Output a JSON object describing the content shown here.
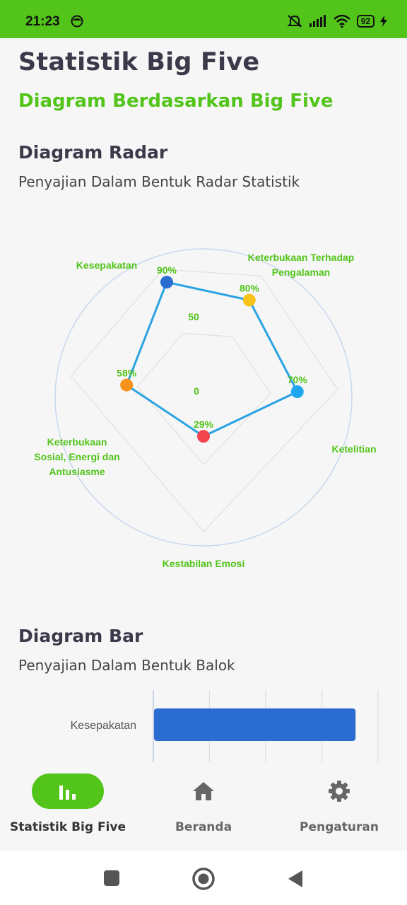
{
  "status_bar": {
    "time": "21:23",
    "battery": "92"
  },
  "page": {
    "title": "Statistik Big Five",
    "subtitle": "Diagram Berdasarkan Big Five"
  },
  "radar_section": {
    "title": "Diagram Radar",
    "description": "Penyajian Dalam Bentuk Radar Statistik"
  },
  "bar_section": {
    "title": "Diagram Bar",
    "description": "Penyajian Dalam Bentuk Balok"
  },
  "chart_data": [
    {
      "type": "radar",
      "axes": [
        "Kesepakatan",
        "Keterbukaan Terhadap Pengalaman",
        "Ketelitian",
        "Kestabilan Emosi",
        "Keterbukaan Sosial, Energi dan Antusiasme"
      ],
      "values": [
        90,
        80,
        70,
        29,
        58
      ],
      "value_labels": [
        "90%",
        "80%",
        "70%",
        "29%",
        "58%"
      ],
      "point_colors": [
        "#2a6ccf",
        "#f8c31a",
        "#1ea7ee",
        "#f5464f",
        "#f7931a"
      ],
      "line_color": "#2ba3e3",
      "range": [
        0,
        100
      ],
      "tick_labels": [
        "0",
        "50"
      ],
      "grid": true
    },
    {
      "type": "bar",
      "orientation": "horizontal",
      "categories": [
        "Kesepakatan"
      ],
      "values": [
        90
      ],
      "bar_color": "#2a6ccf",
      "xlim": [
        0,
        100
      ],
      "grid": true
    }
  ],
  "bottom_nav": {
    "items": [
      {
        "label": "Statistik Big Five",
        "icon": "bar-chart-icon",
        "active": true
      },
      {
        "label": "Beranda",
        "icon": "home-icon",
        "active": false
      },
      {
        "label": "Pengaturan",
        "icon": "gear-icon",
        "active": false
      }
    ]
  }
}
